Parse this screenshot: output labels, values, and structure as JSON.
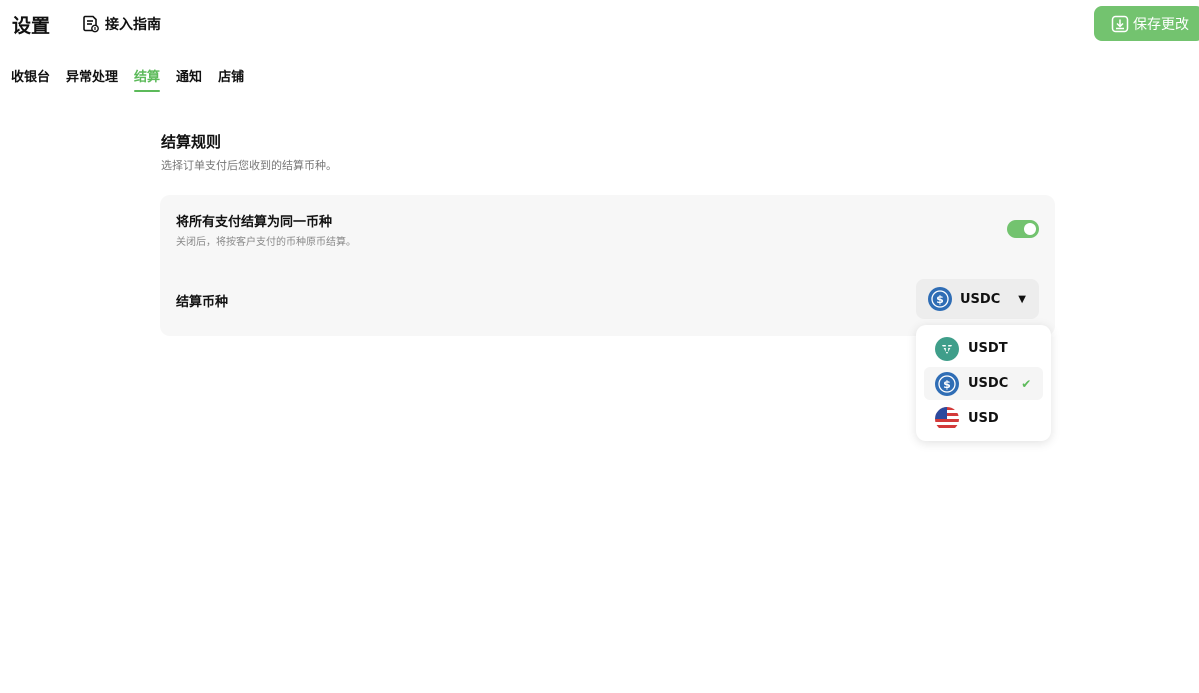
{
  "header": {
    "title": "设置",
    "guide_label": "接入指南",
    "save_label": "保存更改"
  },
  "tabs": [
    {
      "label": "收银台"
    },
    {
      "label": "异常处理"
    },
    {
      "label": "结算",
      "active": true
    },
    {
      "label": "通知"
    },
    {
      "label": "店铺"
    }
  ],
  "section": {
    "title": "结算规则",
    "description": "选择订单支付后您收到的结算币种。"
  },
  "settings": {
    "unify_title": "将所有支付结算为同一币种",
    "unify_description": "关闭后，将按客户支付的币种原币结算。",
    "unify_enabled": true,
    "currency_label": "结算币种",
    "currency_selected": "USDC"
  },
  "dropdown": {
    "options": [
      {
        "label": "USDT",
        "icon": "usdt-icon"
      },
      {
        "label": "USDC",
        "icon": "usdc-icon",
        "selected": true
      },
      {
        "label": "USD",
        "icon": "us-flag-icon"
      }
    ]
  },
  "colors": {
    "accent": "#73c36f",
    "active_tab": "#5cba5a",
    "usdt": "#3f9e8a",
    "usdc": "#2f6db5"
  }
}
